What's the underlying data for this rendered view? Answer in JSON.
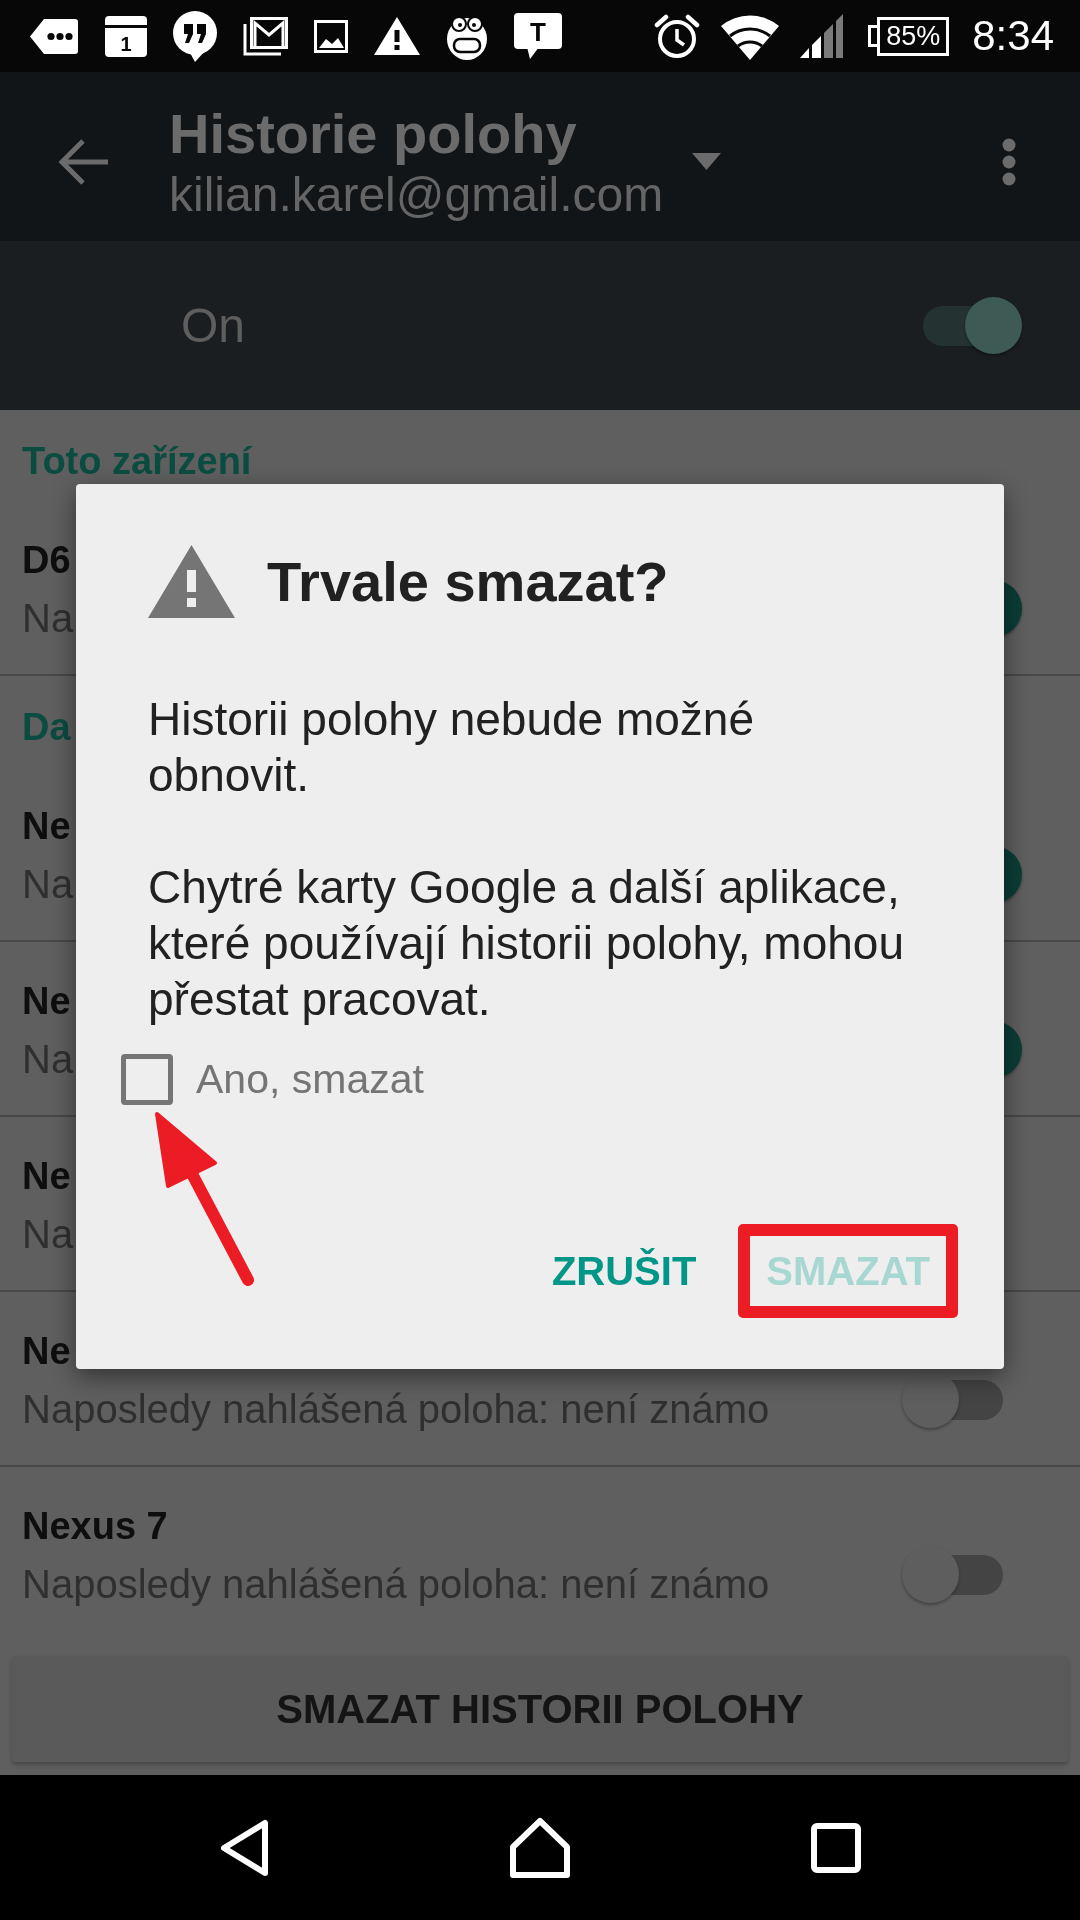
{
  "status_bar": {
    "calendar_day": "1",
    "bubble_letter": "T",
    "battery": "85%",
    "time": "8:34"
  },
  "app_bar": {
    "title": "Historie polohy",
    "account": "kilian.karel@gmail.com"
  },
  "master_switch": {
    "label": "On",
    "on": true
  },
  "sections": [
    {
      "header": "Toto zařízení",
      "devices": [
        {
          "name": "D6",
          "status": "Na",
          "on": true
        }
      ]
    },
    {
      "header": "Da",
      "devices": [
        {
          "name": "Ne",
          "status": "Na",
          "on": true
        },
        {
          "name": "Ne",
          "status": "Na",
          "on": true
        },
        {
          "name": "Ne",
          "status": "Na"
        },
        {
          "name": "Ne",
          "status": "Naposledy nahlášená poloha: není známo",
          "on": false
        },
        {
          "name": "Nexus 7",
          "status": "Naposledy nahlášená poloha: není známo",
          "on": false
        }
      ]
    }
  ],
  "delete_history_button": "SMAZAT HISTORII POLOHY",
  "dialog": {
    "title": "Trvale smazat?",
    "paragraphs": [
      "Historii polohy nebude možné obnovit.",
      "Chytré karty Google a další aplikace, které používají historii polohy, mohou přestat pracovat."
    ],
    "checkbox": {
      "label": "Ano, smazat",
      "checked": false
    },
    "buttons": [
      {
        "label": "ZRUŠIT",
        "disabled": false,
        "annotated": false
      },
      {
        "label": "SMAZAT",
        "disabled": true,
        "annotated": true
      }
    ]
  }
}
